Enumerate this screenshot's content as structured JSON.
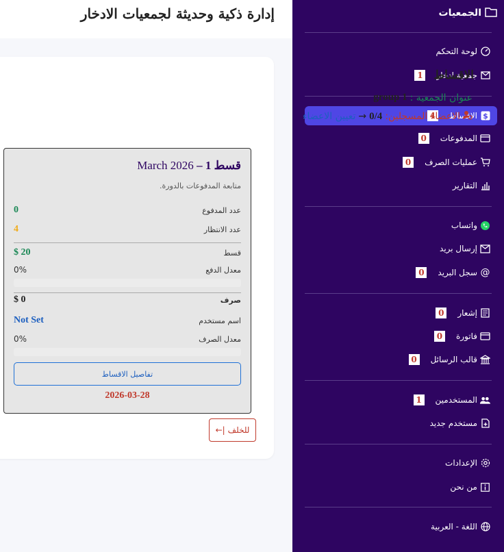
{
  "header": {
    "title": "إدارة ذكية وحديثة لجمعيات الادخار"
  },
  "sidebar": {
    "brand": "الجمعيات",
    "items": {
      "dashboard": {
        "label": "لوحة التحكم"
      },
      "savings": {
        "label": "جمعية ادخار",
        "badge": "1"
      },
      "installments": {
        "label": "الاقساط",
        "badge": "4"
      },
      "payments": {
        "label": "المدفوعات",
        "badge": "0"
      },
      "disbursements": {
        "label": "عمليات الصرف",
        "badge": "0"
      },
      "reports": {
        "label": "التقارير"
      },
      "whatsapp": {
        "label": "واتساب"
      },
      "send_mail": {
        "label": "إرسال بريد"
      },
      "mail_log": {
        "label": "سجل البريد",
        "badge": "0"
      },
      "notices": {
        "label": "إشعار",
        "badge": "0"
      },
      "invoice": {
        "label": "فاتورة",
        "badge": "0"
      },
      "templates": {
        "label": "قالب الرسائل",
        "badge": "0"
      },
      "users": {
        "label": "المستخدمين",
        "badge": "1"
      },
      "new_user": {
        "label": "مستخدم جديد"
      },
      "settings": {
        "label": "الإعدادات"
      },
      "about": {
        "label": "من نحن"
      },
      "language": {
        "label": "اللغة - العربية"
      }
    }
  },
  "main": {
    "panel_title": "الاقساط",
    "group_label": "عنوان الجمعية :",
    "group_value": "group 1",
    "members_label": "الاعضاء المسجلين:",
    "members_value": "0/4",
    "arrow": "→",
    "assign_members": "تعيين الاعضاء",
    "card": {
      "title_prefix": "قسط 1 –",
      "title_date": "March 2026",
      "subtitle": "متابعة المدفوعات بالدورة.",
      "paid_label": "عدد المدفوع",
      "paid_value": "0",
      "pending_label": "عدد الانتظار",
      "pending_value": "4",
      "installment_label": "قسط",
      "installment_value": "20 $",
      "pay_rate_label": "معدل الدفع",
      "pay_rate_value": "0%",
      "pay_rate_fraction": 0,
      "disburse_label": "صرف",
      "disburse_value": "0 $",
      "username_label": "اسم مستخدم",
      "username_value": "Not Set",
      "disburse_rate_label": "معدل الصرف",
      "disburse_rate_value": "0%",
      "disburse_rate_fraction": 0,
      "details_button": "تفاصيل الاقساط",
      "due_date": "2026-03-28"
    },
    "back_button": "للخلف"
  },
  "colors": {
    "sidebar_bg": "#2e0561",
    "active_item": "#4f46e5",
    "success": "#198754",
    "warning": "#f0ad1e",
    "danger": "#c0392b",
    "link": "#1d5fbf"
  },
  "icons": {
    "brand": "folder-icon",
    "dashboard": "speedometer-icon",
    "savings": "envelope-icon",
    "installments": "dollar-icon",
    "payments": "card-icon",
    "disbursements": "cart-icon",
    "reports": "bar-chart-icon",
    "whatsapp": "whatsapp-icon",
    "send_mail": "mail-send-icon",
    "mail_log": "at-icon",
    "notices": "receipt-icon",
    "invoice": "card-icon",
    "templates": "bank-icon",
    "users": "people-icon",
    "new_user": "file-plus-icon",
    "settings": "gear-icon",
    "about": "info-icon",
    "language": "globe-icon",
    "members": "person-gear-icon",
    "back": "arrow-back-icon"
  }
}
